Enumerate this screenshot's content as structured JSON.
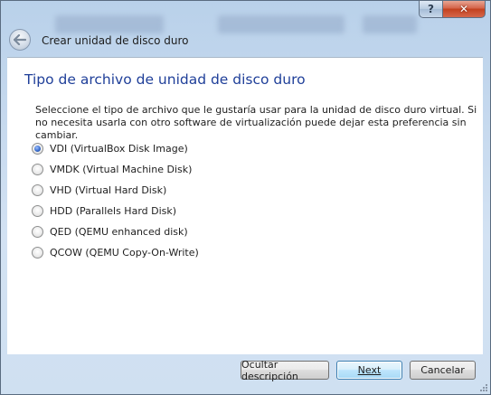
{
  "window": {
    "title": "Crear unidad de disco duro",
    "help_label": "?",
    "close_label": "✕"
  },
  "page": {
    "header": "Tipo de archivo de unidad de disco duro",
    "description": "Seleccione el tipo de archivo que le gustaría usar para la unidad de disco duro virtual. Si no necesita usarla con otro software de virtualización puede dejar esta preferencia sin cambiar."
  },
  "options": [
    {
      "label": "VDI (VirtualBox Disk Image)",
      "checked": true
    },
    {
      "label": "VMDK (Virtual Machine Disk)",
      "checked": false
    },
    {
      "label": "VHD (Virtual Hard Disk)",
      "checked": false
    },
    {
      "label": "HDD (Parallels Hard Disk)",
      "checked": false
    },
    {
      "label": "QED (QEMU enhanced disk)",
      "checked": false
    },
    {
      "label": "QCOW (QEMU Copy-On-Write)",
      "checked": false
    }
  ],
  "buttons": {
    "hide_description": "Ocultar descripción",
    "next": "Next",
    "cancel": "Cancelar"
  },
  "icons": {
    "back": "back-arrow-icon",
    "help": "help-icon",
    "close": "close-icon",
    "grip": "resize-grip-icon"
  },
  "colors": {
    "header_text": "#1f3f99",
    "close_button": "#c3411f",
    "default_button_border": "#3c7fb1"
  }
}
